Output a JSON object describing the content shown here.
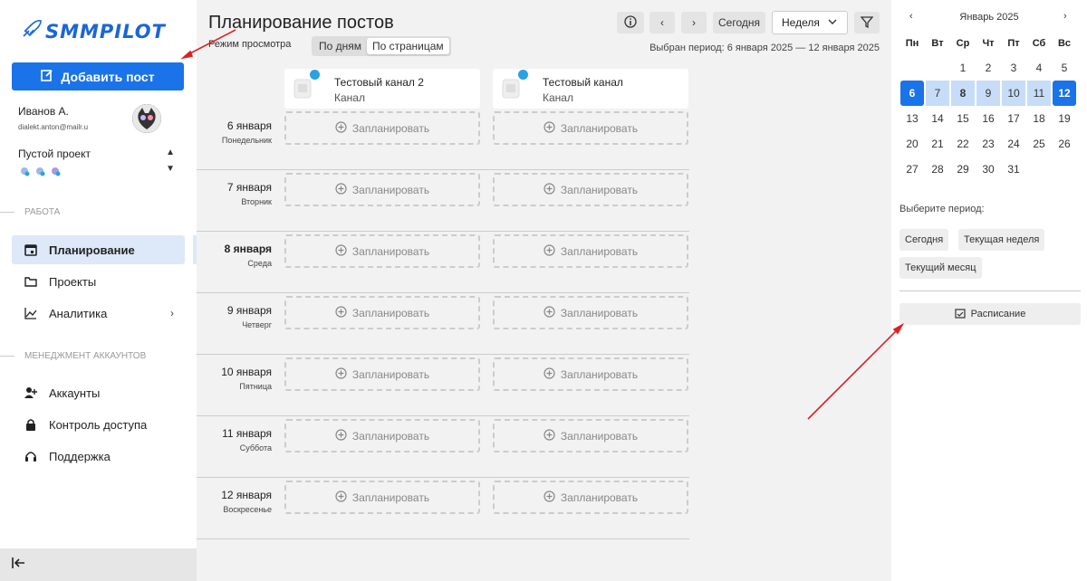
{
  "sidebar": {
    "logo_text": "SMMPILOT",
    "add_post_label": "Добавить пост",
    "user": {
      "name": "Иванов А.",
      "email": "dialekt.anton@mailr.u"
    },
    "project": {
      "name": "Пустой проект"
    },
    "sections": {
      "work": "РАБОТА",
      "accounts": "МЕНЕДЖМЕНТ АККАУНТОВ"
    },
    "items": {
      "planning": "Планирование",
      "projects": "Проекты",
      "analytics": "Аналитика",
      "accounts": "Аккаунты",
      "access": "Контроль доступа",
      "support": "Поддержка"
    }
  },
  "main": {
    "title": "Планирование постов",
    "view_mode_label": "Режим просмотра",
    "view_by_days": "По дням",
    "view_by_pages": "По страницам",
    "today_label": "Сегодня",
    "week_select": "Неделя",
    "period_text": "Выбран период: 6 января 2025 — 12 января 2025",
    "channels": [
      {
        "name": "Тестовый канал 2",
        "type": "Канал"
      },
      {
        "name": "Тестовый канал",
        "type": "Канал"
      }
    ],
    "schedule_label": "Запланировать",
    "days": [
      {
        "date": "6 января",
        "dow": "Понедельник"
      },
      {
        "date": "7 января",
        "dow": "Вторник"
      },
      {
        "date": "8 января",
        "dow": "Среда"
      },
      {
        "date": "9 января",
        "dow": "Четверг"
      },
      {
        "date": "10 января",
        "dow": "Пятница"
      },
      {
        "date": "11 января",
        "dow": "Суббота"
      },
      {
        "date": "12 января",
        "dow": "Воскресенье"
      }
    ]
  },
  "calendar": {
    "month": "Январь 2025",
    "weekdays": [
      "Пн",
      "Вт",
      "Ср",
      "Чт",
      "Пт",
      "Сб",
      "Вс"
    ],
    "weeks": [
      [
        "",
        "",
        "1",
        "2",
        "3",
        "4",
        "5"
      ],
      [
        "6",
        "7",
        "8",
        "9",
        "10",
        "11",
        "12"
      ],
      [
        "13",
        "14",
        "15",
        "16",
        "17",
        "18",
        "19"
      ],
      [
        "20",
        "21",
        "22",
        "23",
        "24",
        "25",
        "26"
      ],
      [
        "27",
        "28",
        "29",
        "30",
        "31",
        "",
        ""
      ]
    ],
    "selected_start": "6",
    "selected_end": "12",
    "today": "8",
    "period_title": "Выберите период:",
    "period_options": [
      "Сегодня",
      "Текущая неделя",
      "Текущий месяц"
    ],
    "schedule_button": "Расписание"
  },
  "colors": {
    "accent": "#1a73e8",
    "range": "#c7ddf7",
    "annotation": "#e02020"
  }
}
